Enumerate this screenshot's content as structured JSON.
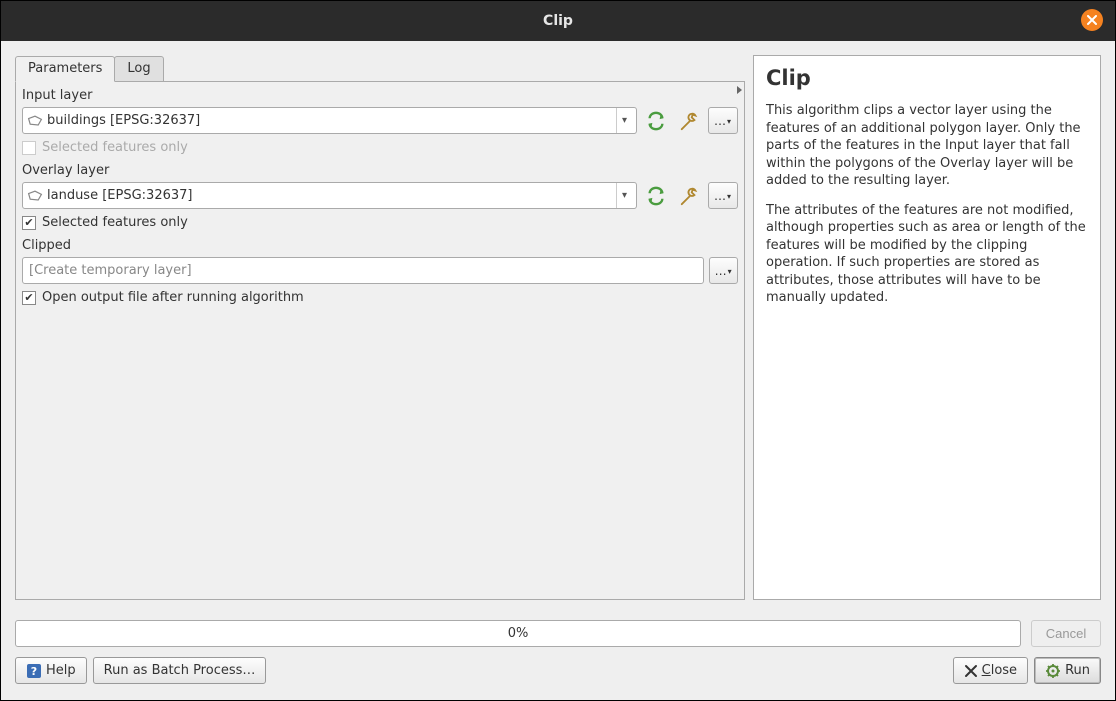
{
  "title": "Clip",
  "tabs": {
    "parameters": "Parameters",
    "log": "Log",
    "active": "parameters"
  },
  "input_layer": {
    "label": "Input layer",
    "value": "buildings [EPSG:32637]",
    "selected_only_label": "Selected features only",
    "selected_only_checked": false,
    "selected_only_enabled": false
  },
  "overlay_layer": {
    "label": "Overlay layer",
    "value": "landuse [EPSG:32637]",
    "selected_only_label": "Selected features only",
    "selected_only_checked": true,
    "selected_only_enabled": true
  },
  "output": {
    "label": "Clipped",
    "placeholder": "[Create temporary layer]",
    "open_after_label": "Open output file after running algorithm",
    "open_after_checked": true
  },
  "help": {
    "title": "Clip",
    "p1": "This algorithm clips a vector layer using the features of an additional polygon layer. Only the parts of the features in the Input layer that fall within the polygons of the Overlay layer will be added to the resulting layer.",
    "p2": "The attributes of the features are not modified, although properties such as area or length of the features will be modified by the clipping operation. If such properties are stored as attributes, those attributes will have to be manually updated."
  },
  "progress": {
    "text": "0%",
    "cancel_label": "Cancel"
  },
  "buttons": {
    "help": "Help",
    "batch": "Run as Batch Process…",
    "close_prefix": "C",
    "close_rest": "lose",
    "run": "Run"
  }
}
